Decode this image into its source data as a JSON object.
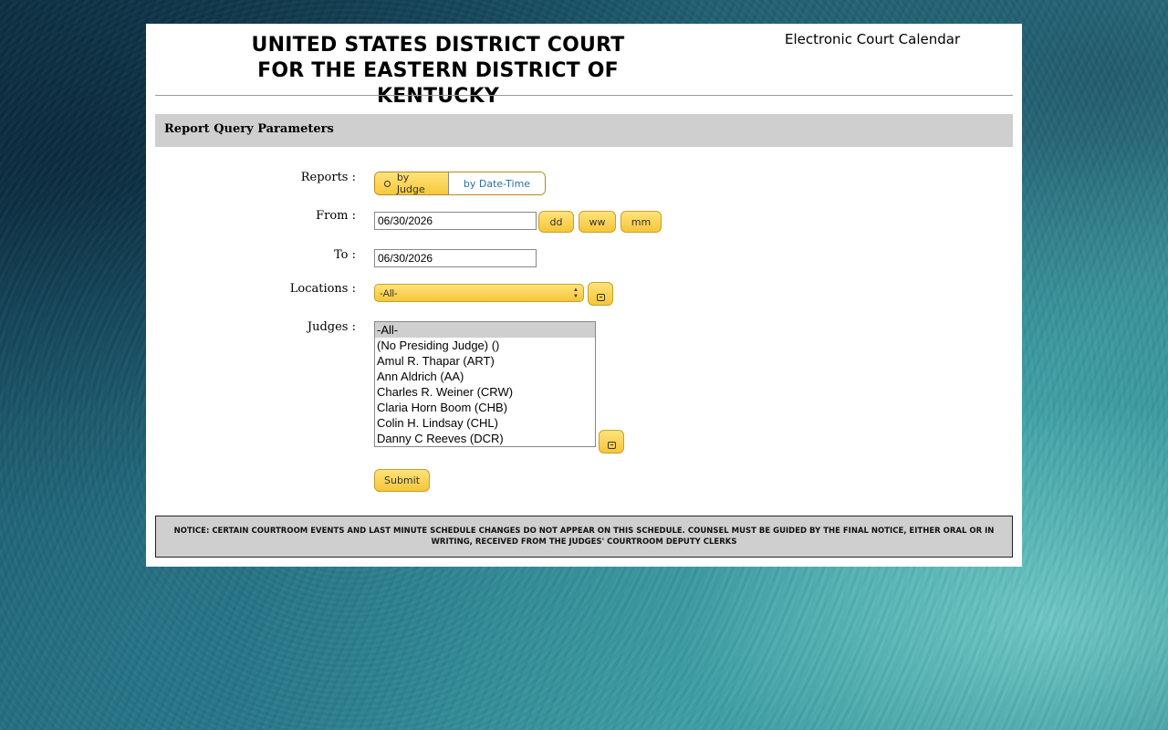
{
  "header": {
    "court_line1": "UNITED STATES DISTRICT COURT",
    "court_line2": "FOR THE EASTERN DISTRICT OF KENTUCKY",
    "app_title": "Electronic Court Calendar"
  },
  "section": {
    "title": "Report Query Parameters"
  },
  "form": {
    "reports_label": "Reports :",
    "reports_options": [
      "by Judge",
      "by Date-Time"
    ],
    "reports_selected": "by Judge",
    "from_label": "From :",
    "from_value": "06/30/2026",
    "quick_buttons": [
      "dd",
      "ww",
      "mm"
    ],
    "to_label": "To :",
    "to_value": "06/30/2026",
    "locations_label": "Locations :",
    "locations_value": "-All-",
    "judges_label": "Judges :",
    "judges_list": [
      "-All-",
      "(No Presiding Judge) ()",
      "Amul R. Thapar (ART)",
      "Ann Aldrich (AA)",
      "Charles R. Weiner (CRW)",
      "Claria Horn Boom (CHB)",
      "Colin H. Lindsay (CHL)",
      "Danny C Reeves (DCR)"
    ],
    "judges_selected": "-All-",
    "submit_label": "Submit"
  },
  "notice": {
    "text": "NOTICE: CERTAIN COURTROOM EVENTS AND LAST MINUTE SCHEDULE CHANGES DO NOT APPEAR ON THIS SCHEDULE. COUNSEL MUST BE GUIDED BY THE FINAL NOTICE, EITHER ORAL OR IN WRITING, RECEIVED FROM THE JUDGES' COURTROOM DEPUTY CLERKS"
  },
  "colors": {
    "accent_yellow": "#f7c83a",
    "section_gray": "#cfcfcf",
    "link_blue": "#2a6fa5"
  }
}
